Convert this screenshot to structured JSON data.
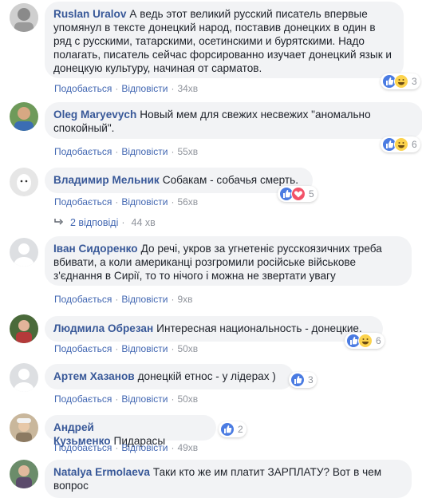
{
  "comments": [
    {
      "author": "Ruslan Uralov",
      "text": "А ведь этот великий русский писатель впервые упомянул в тексте донецкий народ, поставив донецких в один в ряд с русскими, татарскими, осетинскими и бурятскими. Надо полагать, писатель сейчас форсированно изучает донецкий язык и донецкую культуру, начиная от сарматов.",
      "like": "Подобається",
      "reply": "Відповісти",
      "time": "34хв",
      "reactions": [
        "like-icon",
        "haha-icon"
      ],
      "reaction_count": "3"
    },
    {
      "author": "Oleg Maryevych",
      "text": "Новый мем для свежих несвежих \"аномально спокойный\".",
      "like": "Подобається",
      "reply": "Відповісти",
      "time": "55хв",
      "reactions": [
        "like-icon",
        "haha-icon"
      ],
      "reaction_count": "6"
    },
    {
      "author": "Владимир Мельник",
      "text": "Собакам - собачья смерть.",
      "like": "Подобається",
      "reply": "Відповісти",
      "time": "56хв",
      "reactions": [
        "like-icon",
        "love-icon"
      ],
      "reaction_count": "5",
      "replies_label": "2 відповіді",
      "replies_time": "44 хв"
    },
    {
      "author": "Іван Сидоренко",
      "text": "До речі, укров за угнетеніє русскоязичних треба вбивати, а коли американці розгромили російське військове з'єднання в Сирії, то то нічого і можна не звертати увагу",
      "like": "Подобається",
      "reply": "Відповісти",
      "time": "9хв"
    },
    {
      "author": "Людмила Обрезан",
      "text": "Интересная национальность - донецкие.",
      "like": "Подобається",
      "reply": "Відповісти",
      "time": "50хв",
      "reactions": [
        "like-icon",
        "haha-icon"
      ],
      "reaction_count": "6"
    },
    {
      "author": "Артем Хазанов",
      "text": "донецкій етнос - у лідерах )",
      "like": "Подобається",
      "reply": "Відповісти",
      "time": "50хв",
      "reactions": [
        "like-icon"
      ],
      "reaction_count": "3"
    },
    {
      "author": "Андрей Кузьменко",
      "text": "Пидарасы",
      "like": "Подобається",
      "reply": "Відповісти",
      "time": "49хв",
      "reactions": [
        "like-icon"
      ],
      "reaction_count": "2"
    },
    {
      "author": "Natalya Ermolaeva",
      "text": "Таки кто же им платит ЗАРПЛАТУ? Вот в чем вопрос"
    }
  ],
  "colors": {
    "author": "#385898",
    "link": "#4267b2",
    "muted": "#90949c",
    "bubble": "#f2f3f5"
  }
}
